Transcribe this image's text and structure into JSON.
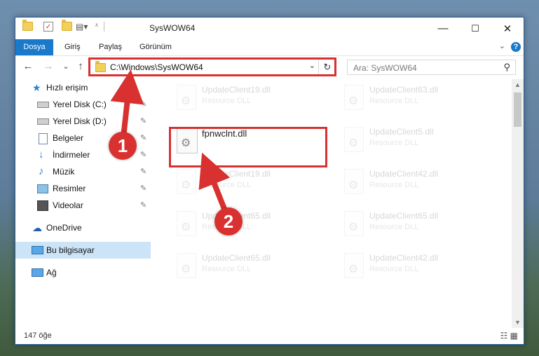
{
  "window": {
    "title": "SysWOW64",
    "minimize": "—",
    "maximize": "☐",
    "close": "✕"
  },
  "ribbon": {
    "tabs": [
      "Dosya",
      "Giriş",
      "Paylaş",
      "Görünüm"
    ],
    "expand": "⌄",
    "help": "?"
  },
  "nav": {
    "back": "←",
    "forward": "→",
    "recent": "⌄",
    "up": "↑",
    "address": "C:\\Windows\\SysWOW64",
    "address_dropdown": "⌄",
    "refresh": "↻",
    "search_placeholder": "Ara: SysWOW64",
    "search_icon": "⚲"
  },
  "sidebar": {
    "items": [
      {
        "label": "Hızlı erişim",
        "icon": "star-icon",
        "pinned": false
      },
      {
        "label": "Yerel Disk (C:)",
        "icon": "drive-icon",
        "pinned": true
      },
      {
        "label": "Yerel Disk (D:)",
        "icon": "drive-icon",
        "pinned": true
      },
      {
        "label": "Belgeler",
        "icon": "documents-icon",
        "pinned": true
      },
      {
        "label": "İndirmeler",
        "icon": "downloads-icon",
        "pinned": true
      },
      {
        "label": "Müzik",
        "icon": "music-icon",
        "pinned": true
      },
      {
        "label": "Resimler",
        "icon": "pictures-icon",
        "pinned": true
      },
      {
        "label": "Videolar",
        "icon": "videos-icon",
        "pinned": true
      },
      {
        "label": "OneDrive",
        "icon": "cloud-icon",
        "pinned": false
      },
      {
        "label": "Bu bilgisayar",
        "icon": "computer-icon",
        "pinned": false,
        "selected": true
      },
      {
        "label": "Ağ",
        "icon": "network-icon",
        "pinned": false
      }
    ],
    "pin_glyph": "📌"
  },
  "files": {
    "left_column": [
      {
        "name": "UpdateClient19.dll",
        "type": "Resource DLL"
      },
      {
        "name": "fpnwclnt.dll",
        "type": "",
        "focused": true
      },
      {
        "name": "UpdateClient19.dll",
        "type": "Resource DLL"
      },
      {
        "name": "UpdateClient65.dll",
        "type": "Resource DLL"
      },
      {
        "name": "UpdateClient65.dll",
        "type": "Resource DLL"
      }
    ],
    "right_column": [
      {
        "name": "UpdateClient63.dll",
        "type": "Resource DLL"
      },
      {
        "name": "UpdateClient5.dll",
        "type": "Resource DLL"
      },
      {
        "name": "UpdateClient42.dll",
        "type": "Resource DLL"
      },
      {
        "name": "UpdateClient65.dll",
        "type": "Resource DLL"
      },
      {
        "name": "UpdateClient42.dll",
        "type": "Resource DLL"
      }
    ]
  },
  "status": {
    "item_count": "147 öğe",
    "view_icons": "☷ ▦"
  },
  "annotations": {
    "marker1": "1",
    "marker2": "2",
    "color": "#d8312f"
  }
}
